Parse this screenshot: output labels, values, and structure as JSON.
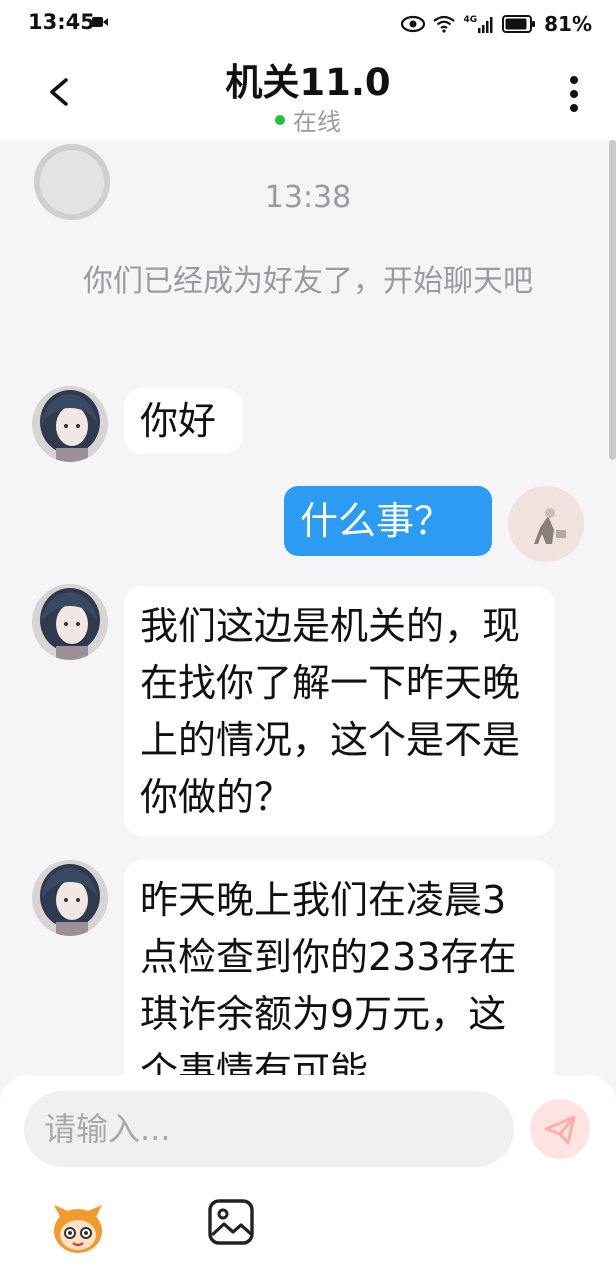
{
  "status_bar": {
    "time": "13:45",
    "battery": "81%",
    "network": "4G"
  },
  "header": {
    "title": "机关11.0",
    "status": "在线"
  },
  "chat": {
    "timestamp": "13:38",
    "system_message": "你们已经成为好友了，开始聊天吧",
    "messages": [
      {
        "side": "other",
        "text": "你好"
      },
      {
        "side": "self",
        "text": "什么事？"
      },
      {
        "side": "other",
        "text": "我们这边是机关的，现在找你了解一下昨天晚上的情况，这个是不是你做的？"
      },
      {
        "side": "other",
        "text": "昨天晚上我们在凌晨3点检查到你的233存在琪诈余额为9万元，这个事情有可能"
      }
    ]
  },
  "input": {
    "placeholder": "请输入..."
  },
  "colors": {
    "accent": "#2b9bf4",
    "online": "#20c24a",
    "send_disabled": "#fde3e1"
  }
}
